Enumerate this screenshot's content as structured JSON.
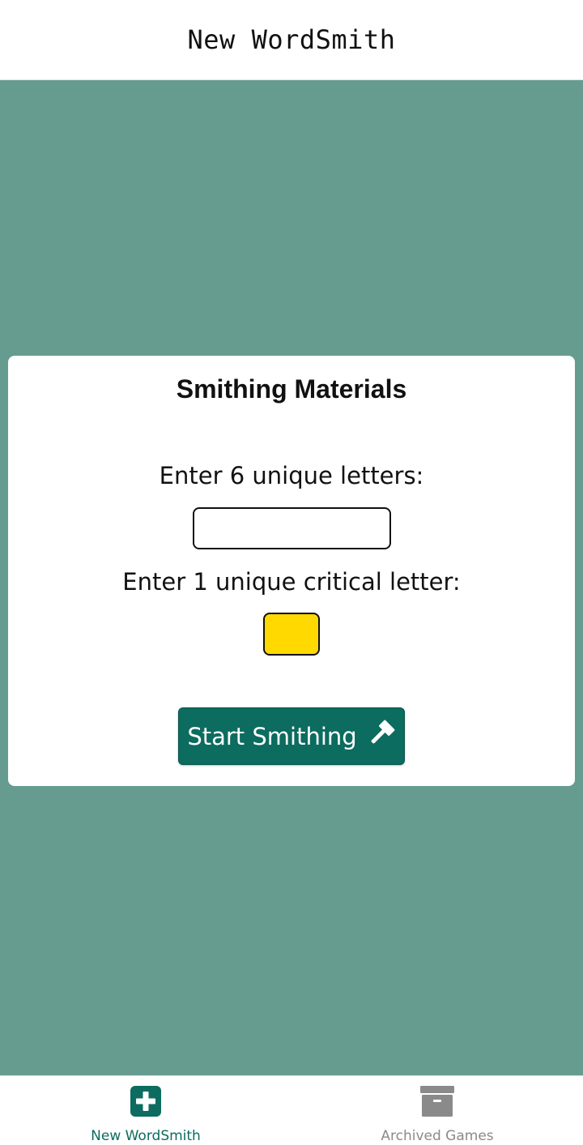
{
  "header": {
    "title": "New WordSmith"
  },
  "card": {
    "title": "Smithing Materials",
    "letters_label": "Enter 6 unique letters:",
    "letters_value": "",
    "critical_label": "Enter 1 unique critical letter:",
    "critical_value": "",
    "start_button_label": "Start Smithing",
    "start_button_icon": "hammer-icon"
  },
  "bottom_nav": {
    "items": [
      {
        "label": "New WordSmith",
        "icon": "plus-square-icon",
        "active": true
      },
      {
        "label": "Archived Games",
        "icon": "archive-box-icon",
        "active": false
      }
    ]
  },
  "colors": {
    "background": "#669c90",
    "accent": "#0b6c5f",
    "critical_input": "#ffd900",
    "inactive_nav": "#8a8a8a"
  }
}
